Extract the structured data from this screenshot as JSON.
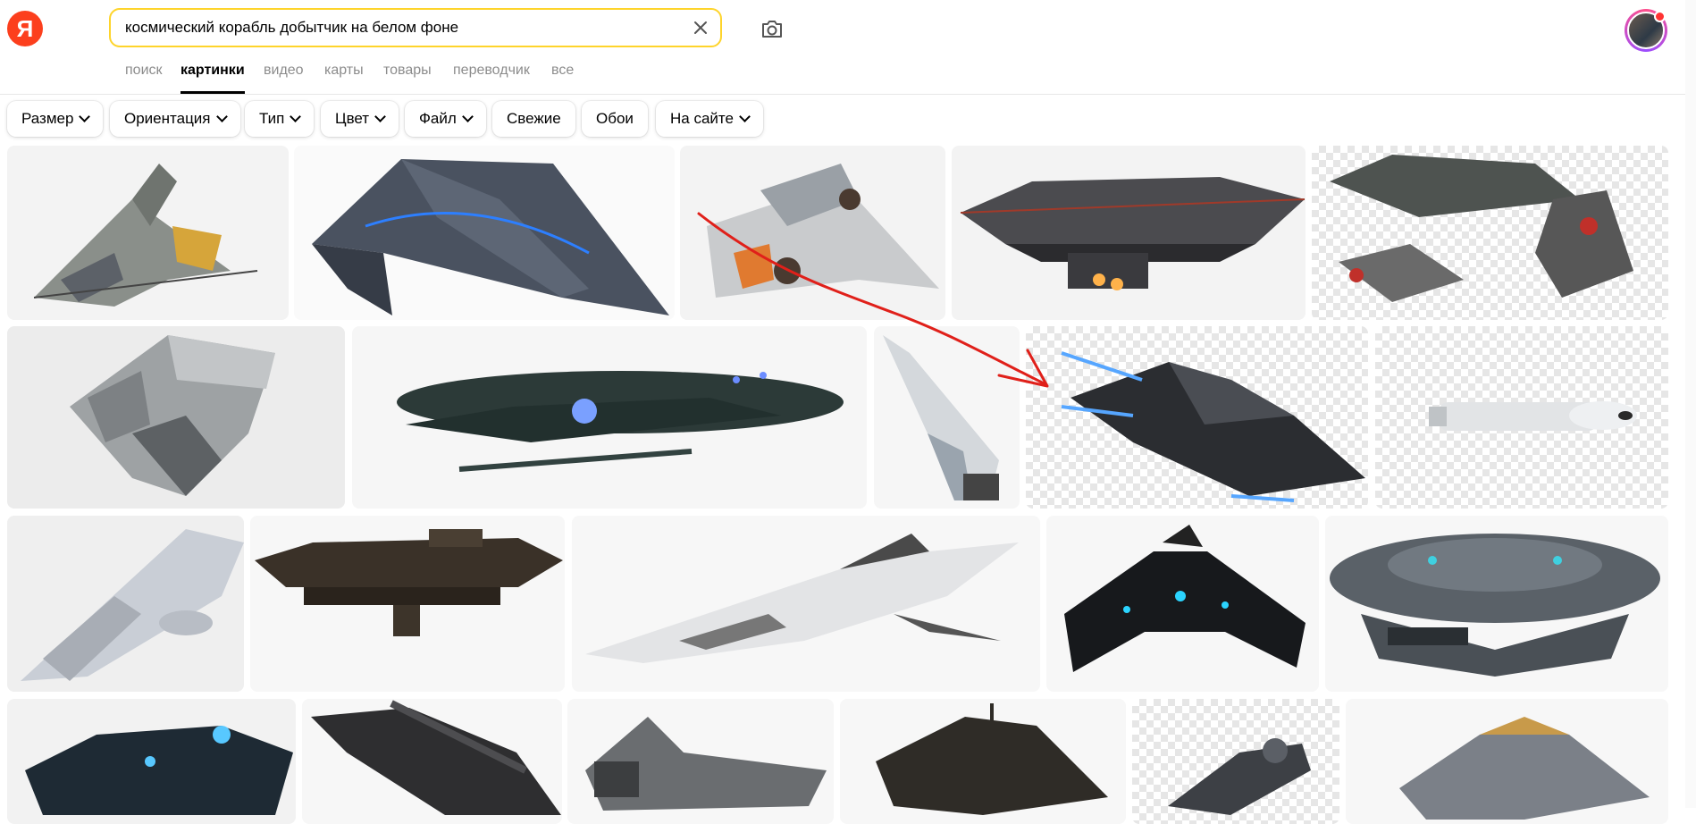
{
  "search": {
    "query": "космический корабль добытчик на белом фоне"
  },
  "logo": {
    "letter": "Я"
  },
  "tabs": [
    {
      "label": "поиск"
    },
    {
      "label": "картинки"
    },
    {
      "label": "видео"
    },
    {
      "label": "карты"
    },
    {
      "label": "товары"
    },
    {
      "label": "переводчик"
    },
    {
      "label": "все"
    }
  ],
  "filters": [
    {
      "label": "Размер"
    },
    {
      "label": "Ориентация"
    },
    {
      "label": "Тип"
    },
    {
      "label": "Цвет"
    },
    {
      "label": "Файл"
    },
    {
      "label": "Свежие"
    },
    {
      "label": "Обои"
    },
    {
      "label": "На сайте"
    }
  ],
  "icons": {
    "clear": "close-icon",
    "camera": "camera-search-icon",
    "filter_dropdown": "chevron-down-icon"
  },
  "colors": {
    "accent_search_border": "#fed42b",
    "logo_red": "#fc3f1d",
    "annotation_arrow": "#e0201a"
  }
}
